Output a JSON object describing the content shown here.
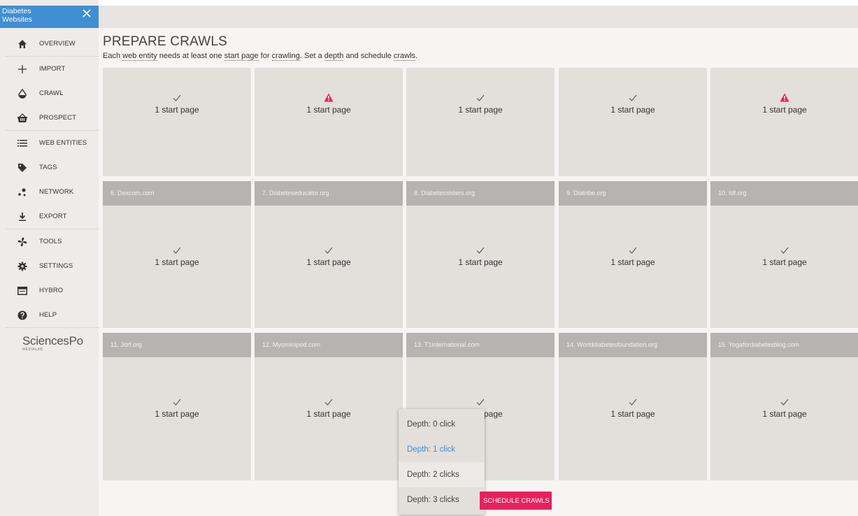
{
  "corpus": {
    "name": "Diabetes Websites"
  },
  "nav": [
    {
      "label": "OVERVIEW",
      "icon": "home-icon"
    },
    {
      "label": "IMPORT",
      "icon": "plus-icon"
    },
    {
      "label": "CRAWL",
      "icon": "drop-icon"
    },
    {
      "label": "PROSPECT",
      "icon": "basket-icon"
    },
    {
      "label": "WEB ENTITIES",
      "icon": "list-icon"
    },
    {
      "label": "TAGS",
      "icon": "tag-icon"
    },
    {
      "label": "NETWORK",
      "icon": "network-icon"
    },
    {
      "label": "EXPORT",
      "icon": "download-icon"
    },
    {
      "label": "TOOLS",
      "icon": "fan-icon"
    },
    {
      "label": "SETTINGS",
      "icon": "gear-icon"
    },
    {
      "label": "HYBRO",
      "icon": "window-icon"
    },
    {
      "label": "HELP",
      "icon": "question-icon"
    }
  ],
  "logo": {
    "main": "SciencesPo",
    "sub": "MEDIALAB"
  },
  "header": {
    "title": "PREPARE CRAWLS",
    "desc_1": "Each ",
    "term_web_entity": "web entity",
    "desc_2": " needs at least one ",
    "term_start_page": "start page",
    "desc_3": " for ",
    "term_crawling": "crawling",
    "desc_4": ". Set a ",
    "term_depth": "depth",
    "desc_5": " and schedule ",
    "term_crawls": "crawls",
    "desc_6": "."
  },
  "cards": [
    {
      "title": "",
      "status": "ok",
      "text": "1 start page"
    },
    {
      "title": "",
      "status": "warning",
      "text": "1 start page"
    },
    {
      "title": "",
      "status": "ok",
      "text": "1 start page"
    },
    {
      "title": "",
      "status": "ok",
      "text": "1 start page"
    },
    {
      "title": "",
      "status": "warning",
      "text": "1 start page"
    },
    {
      "title": "6. Dexcom.com",
      "status": "ok",
      "text": "1 start page"
    },
    {
      "title": "7. Diabeteseducator.org",
      "status": "ok",
      "text": "1 start page"
    },
    {
      "title": "8. Diabetessisters.org",
      "status": "ok",
      "text": "1 start page"
    },
    {
      "title": "9. Diatribe.org",
      "status": "ok",
      "text": "1 start page"
    },
    {
      "title": "10. Idf.org",
      "status": "ok",
      "text": "1 start page"
    },
    {
      "title": "11. Jdrf.org",
      "status": "ok",
      "text": "1 start page"
    },
    {
      "title": "12. Myominipod.com",
      "status": "ok",
      "text": "1 start page"
    },
    {
      "title": "13. T1international.com",
      "status": "ok",
      "text": "1 start page"
    },
    {
      "title": "14. Worlddiabetesfoundation.org",
      "status": "ok",
      "text": "1 start page"
    },
    {
      "title": "15. Yogafordiabetesblog.com",
      "status": "ok",
      "text": "1 start page"
    }
  ],
  "depth_menu": {
    "options": [
      "Depth: 0 click",
      "Depth: 1 click",
      "Depth: 2 clicks",
      "Depth: 3 clicks"
    ],
    "selected_index": 1
  },
  "schedule_button": {
    "label": "SCHEDULE CRAWLS"
  },
  "colors": {
    "accent": "#3f8fd2",
    "warning": "#e8215e",
    "button": "#e8215e"
  }
}
